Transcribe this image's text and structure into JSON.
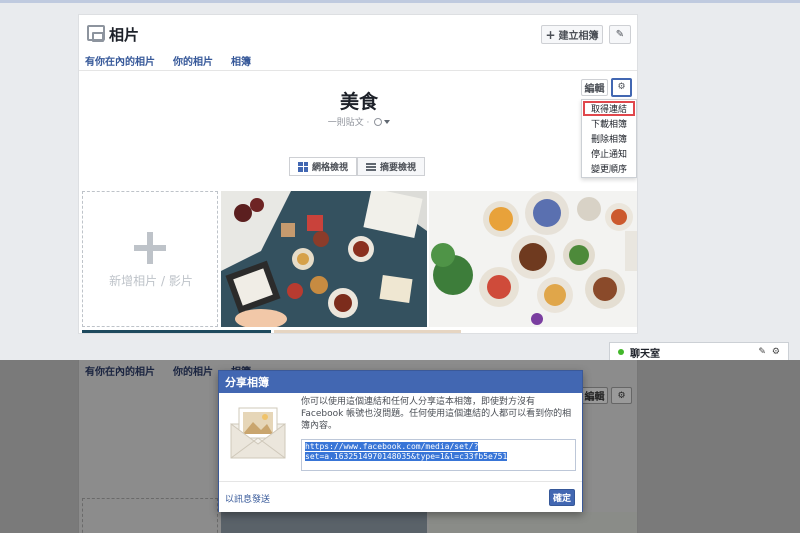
{
  "header": {
    "title": "相片",
    "create_album_label": "建立相簿"
  },
  "tabs": [
    {
      "label": "有你在內的相片"
    },
    {
      "label": "你的相片"
    },
    {
      "label": "相簿"
    }
  ],
  "album": {
    "title": "美食",
    "meta": "一則貼文 ·",
    "edit_label": "編輯"
  },
  "dropdown": {
    "items": [
      {
        "label": "取得連結",
        "highlighted": true
      },
      {
        "label": "下載相簿"
      },
      {
        "label": "刪除相簿"
      },
      {
        "label": "停止通知"
      },
      {
        "label": "變更順序"
      }
    ]
  },
  "view_toggle": {
    "grid_label": "網格檢視",
    "summary_label": "摘要檢視"
  },
  "add_photo": {
    "label": "新增相片 / 影片"
  },
  "chat": {
    "label": "聊天室"
  },
  "dialog": {
    "title": "分享相簿",
    "description": "你可以使用這個連結和任何人分享這本相簿，即使對方沒有 Facebook 帳號也沒問題。任何使用這個連結的人都可以看到你的相簿內容。",
    "link": "https://www.facebook.com/media/set/?set=a.1632514970148035&type=1&l=c33fb5e751",
    "send_message_label": "以訊息發送",
    "ok_label": "確定"
  },
  "colors": {
    "brand": "#4267b2",
    "link": "#365899",
    "highlight": "#e0474c"
  }
}
